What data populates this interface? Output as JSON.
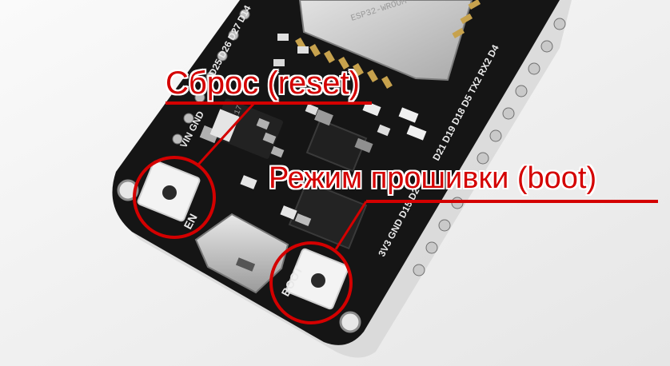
{
  "annotations": {
    "reset_label": "Сброс (reset)",
    "boot_label": "Режим прошивки (boot)"
  },
  "silkscreen": {
    "en": "EN",
    "boot": "BOOT",
    "left_pins": "D25 D26 D27 D14",
    "right_pins": "D21 D19 D18 D5 TX2 RX2 D4",
    "bottom_right_pins": "3V3 GND D15 D2",
    "vin_gnd": "VIN GND"
  },
  "colors": {
    "annotation": "#d40000",
    "board": "#151515",
    "background": "#f2f2f2",
    "shield": "#c8c8c8"
  }
}
